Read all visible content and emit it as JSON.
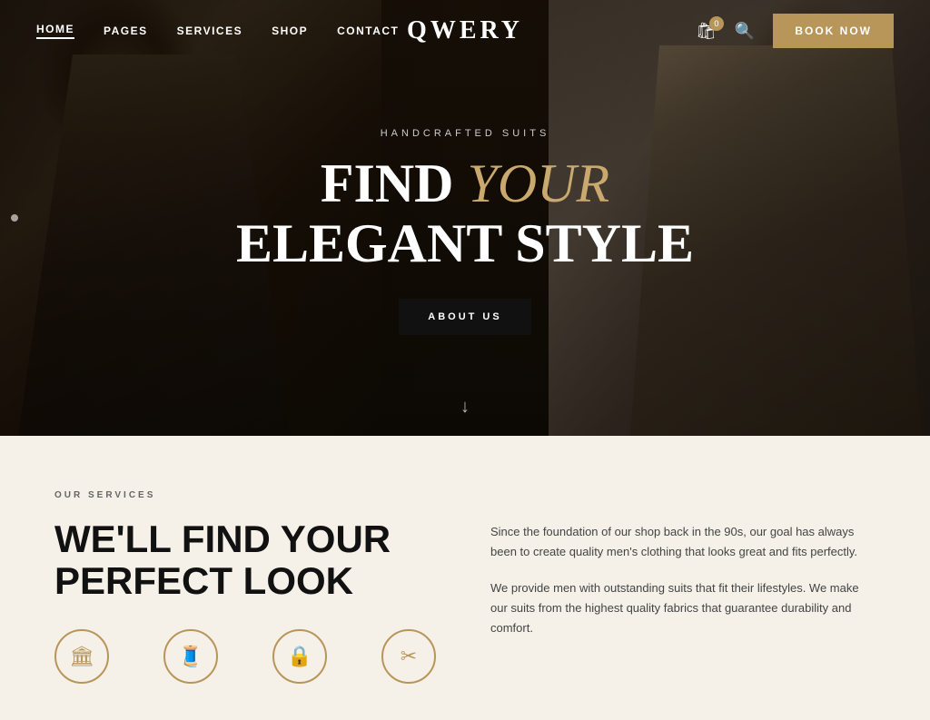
{
  "navbar": {
    "logo": "QWERY",
    "nav_links": [
      {
        "label": "HOME",
        "active": true
      },
      {
        "label": "PAGES",
        "active": false
      },
      {
        "label": "SERVICES",
        "active": false
      },
      {
        "label": "SHOP",
        "active": false
      },
      {
        "label": "CONTACT",
        "active": false
      }
    ],
    "book_now": "BOOK NOW",
    "cart_count": "0"
  },
  "hero": {
    "subtitle": "HANDCRAFTED SUITS",
    "title_line1": "FIND ",
    "title_italic": "YOUR",
    "title_line2": "ELEGANT STYLE",
    "cta_button": "ABOUT US",
    "scroll_arrow": "↓"
  },
  "services": {
    "section_label": "OUR SERVICES",
    "heading_line1": "WE'LL FIND YOUR",
    "heading_line2": "PERFECT LOOK",
    "para1": "Since the foundation of our shop back in the 90s, our goal has always been to create quality men's clothing that looks great and fits perfectly.",
    "para2": "We provide men with outstanding suits that fit their lifestyles. We make our suits from the highest quality fabrics that guarantee durability and comfort.",
    "icons": [
      {
        "symbol": "🏛",
        "name": "icon-tailoring"
      },
      {
        "symbol": "🧵",
        "name": "icon-fabric"
      },
      {
        "symbol": "🔒",
        "name": "icon-quality"
      },
      {
        "symbol": "✂",
        "name": "icon-custom"
      }
    ]
  }
}
